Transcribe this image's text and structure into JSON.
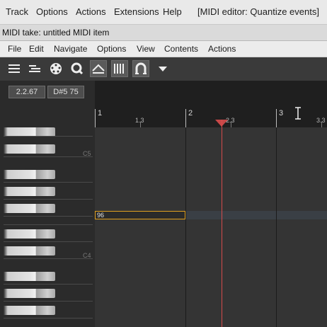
{
  "app_menu": [
    "Track",
    "Options",
    "Actions",
    "Extensions",
    "Help",
    "[MIDI editor: Quantize events]"
  ],
  "window_title": "MIDI take: untitled MIDI item",
  "editor_menu": [
    "File",
    "Edit",
    "Navigate",
    "Options",
    "View",
    "Contents",
    "Actions"
  ],
  "toolbar_icons": [
    "hamburger-list-icon",
    "notation-lines-icon",
    "midi-din-icon",
    "quantize-q-icon",
    "triangle-mountain-icon",
    "grid-bars-icon",
    "magnet-snap-icon",
    "dropdown-arrow-icon"
  ],
  "info": {
    "position": "2.2.67",
    "note": "D#5  75"
  },
  "ruler": {
    "labels": [
      "1",
      "2",
      "3"
    ],
    "sublabels": [
      "1.3",
      "2.3",
      "3.3"
    ]
  },
  "piano": {
    "octave_labels": [
      "C5",
      "C4"
    ]
  },
  "note": {
    "velocity_label": "96"
  },
  "colors": {
    "playhead": "#d64b4b",
    "note_border": "#e0a020"
  }
}
